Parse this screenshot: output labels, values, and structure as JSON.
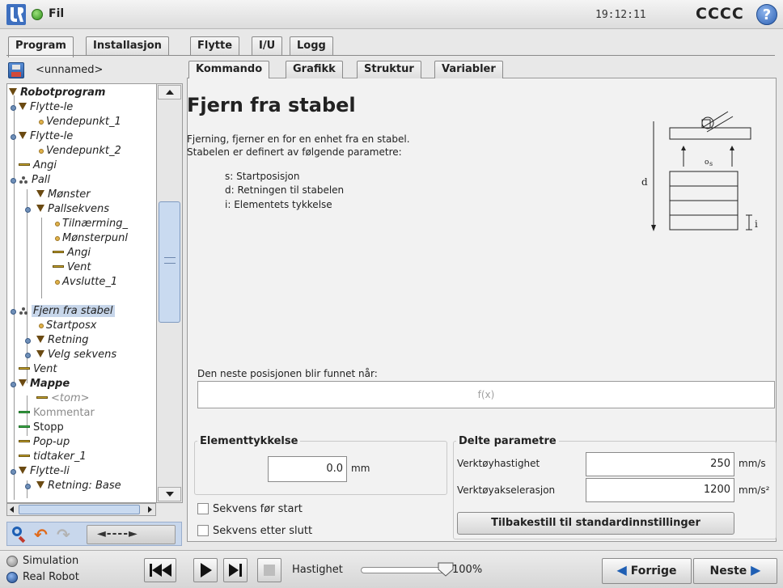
{
  "titlebar": {
    "file_label": "Fil",
    "clock": "19:12:11",
    "robot_name": "CCCC",
    "help_glyph": "?"
  },
  "top_tabs": [
    "Program",
    "Installasjon",
    "Flytte",
    "I/U",
    "Logg"
  ],
  "program": {
    "name": "<unnamed>"
  },
  "sub_tabs": [
    "Kommando",
    "Grafikk",
    "Struktur",
    "Variabler"
  ],
  "tree": [
    {
      "label": "Robotprogram",
      "icon": "triangle-icon"
    },
    {
      "label": "Flytte-le",
      "icon": "triangle-icon"
    },
    {
      "label": "Vendepunkt_1",
      "icon": "waypoint-icon"
    },
    {
      "label": "Flytte-le",
      "icon": "triangle-icon"
    },
    {
      "label": "Vendepunkt_2",
      "icon": "waypoint-icon"
    },
    {
      "label": "Angi",
      "icon": "bar-icon"
    },
    {
      "label": "Pall",
      "icon": "pallet-icon"
    },
    {
      "label": "Mønster",
      "icon": "triangle-icon"
    },
    {
      "label": "Pallsekvens",
      "icon": "triangle-icon"
    },
    {
      "label": "Tilnærming_",
      "icon": "waypoint-icon"
    },
    {
      "label": "Mønsterpunl",
      "icon": "waypoint-icon"
    },
    {
      "label": "Angi",
      "icon": "bar-icon"
    },
    {
      "label": "Vent",
      "icon": "bar-icon"
    },
    {
      "label": "Avslutte_1",
      "icon": "waypoint-icon"
    },
    {
      "label": "Fjern fra stabel",
      "icon": "pallet-icon",
      "selected": true
    },
    {
      "label": "Startposx",
      "icon": "waypoint-icon"
    },
    {
      "label": "Retning",
      "icon": "triangle-icon"
    },
    {
      "label": "Velg sekvens",
      "icon": "triangle-icon"
    },
    {
      "label": "Vent",
      "icon": "bar-icon"
    },
    {
      "label": "Mappe",
      "icon": "triangle-icon"
    },
    {
      "label": "<tom>",
      "icon": "bar-icon"
    },
    {
      "label": "Kommentar",
      "icon": "green-bar-icon"
    },
    {
      "label": "Stopp",
      "icon": "green-bar-icon"
    },
    {
      "label": "Pop-up",
      "icon": "bar-icon"
    },
    {
      "label": "tidtaker_1",
      "icon": "bar-icon"
    },
    {
      "label": "Flytte-li",
      "icon": "triangle-icon"
    },
    {
      "label": "Retning: Base",
      "icon": "triangle-icon"
    }
  ],
  "tree_toolbar": {
    "move_label": "◄----►"
  },
  "command": {
    "title": "Fjern fra stabel",
    "desc_1": "Fjerning, fjerner en for en enhet fra en stabel.",
    "desc_2": "Stabelen er definert av følgende parametre:",
    "params": [
      "s: Startposisjon",
      "d: Retningen til stabelen",
      "i: Elementets tykkelse"
    ],
    "diagram_labels": {
      "d": "d",
      "i": "i",
      "s": "s"
    },
    "next_label": "Den neste posisjonen blir funnet når:",
    "expression": "f(x)",
    "thickness": {
      "title": "Elementtykkelse",
      "value": "0.0",
      "unit": "mm"
    },
    "checkbox_before": "Sekvens før start",
    "checkbox_after": "Sekvens etter slutt",
    "shared": {
      "title": "Delte parametre",
      "speed_label": "Verktøyhastighet",
      "speed_value": "250",
      "speed_unit": "mm/s",
      "accel_label": "Verktøyakselerasjon",
      "accel_value": "1200",
      "accel_unit": "mm/s²",
      "reset_label": "Tilbakestill til standardinnstillinger"
    }
  },
  "bottombar": {
    "simulation_label": "Simulation",
    "real_robot_label": "Real Robot",
    "speed_label": "Hastighet",
    "speed_value": "100%",
    "speed_fraction": 1.0,
    "prev_label": "Forrige",
    "next_label": "Neste"
  },
  "colors": {
    "accent": "#1f5fb4",
    "selection": "#c7d6ea",
    "toolbar": "#c8d7ec"
  }
}
